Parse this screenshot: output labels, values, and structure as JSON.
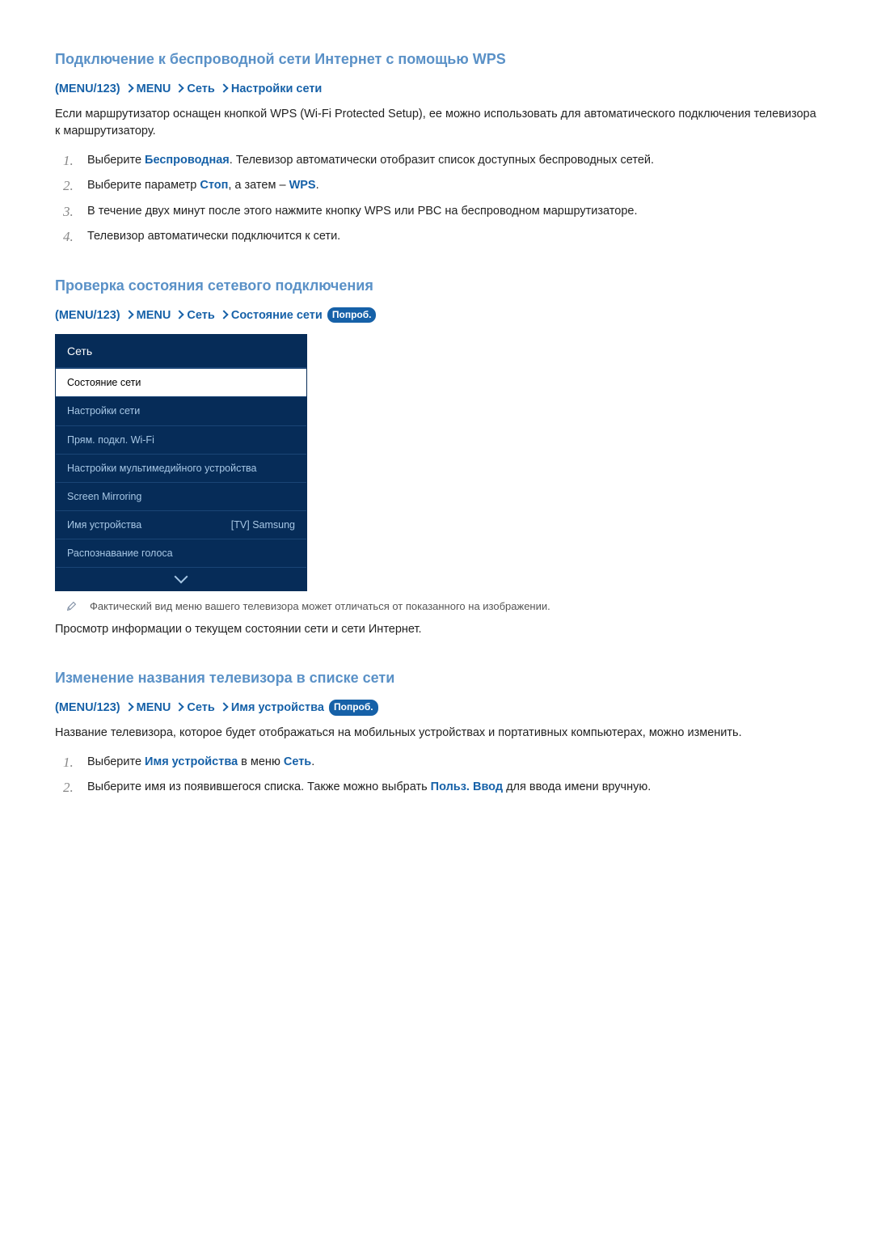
{
  "section1": {
    "heading": "Подключение к беспроводной сети Интернет с помощью WPS",
    "bc": {
      "a": "MENU/123",
      "b": "MENU",
      "c": "Сеть",
      "d": "Настройки сети"
    },
    "intro": "Если маршрутизатор оснащен кнопкой WPS (Wi-Fi Protected Setup), ее можно использовать для автоматического подключения телевизора к маршрутизатору.",
    "steps": {
      "s1a": "Выберите ",
      "s1b": "Беспроводная",
      "s1c": ". Телевизор автоматически отобразит список доступных беспроводных сетей.",
      "s2a": "Выберите параметр ",
      "s2b": "Стоп",
      "s2c": ", а затем – ",
      "s2d": "WPS",
      "s2e": ".",
      "s3": "В течение двух минут после этого нажмите кнопку WPS или PBC на беспроводном маршрутизаторе.",
      "s4": "Телевизор автоматически подключится к сети."
    }
  },
  "section2": {
    "heading": "Проверка состояния сетевого подключения",
    "bc": {
      "a": "MENU/123",
      "b": "MENU",
      "c": "Сеть",
      "d": "Состояние сети"
    },
    "try": "Попроб.",
    "menu": {
      "header": "Сеть",
      "i0": "Состояние сети",
      "i1": "Настройки сети",
      "i2": "Прям. подкл. Wi-Fi",
      "i3": "Настройки мультимедийного устройства",
      "i4": "Screen Mirroring",
      "i5": "Имя устройства",
      "i5v": "[TV] Samsung",
      "i6": "Распознавание голоса"
    },
    "note": "Фактический вид меню вашего телевизора может отличаться от показанного на изображении.",
    "para": "Просмотр информации о текущем состоянии сети и сети Интернет."
  },
  "section3": {
    "heading": "Изменение названия телевизора в списке сети",
    "bc": {
      "a": "MENU/123",
      "b": "MENU",
      "c": "Сеть",
      "d": "Имя устройства"
    },
    "try": "Попроб.",
    "intro": "Название телевизора, которое будет отображаться на мобильных устройствах и портативных компьютерах, можно изменить.",
    "steps": {
      "s1a": "Выберите ",
      "s1b": "Имя устройства",
      "s1c": " в меню ",
      "s1d": "Сеть",
      "s1e": ".",
      "s2a": "Выберите имя из появившегося списка. Также можно выбрать ",
      "s2b": "Польз. Ввод",
      "s2c": " для ввода имени вручную."
    }
  }
}
